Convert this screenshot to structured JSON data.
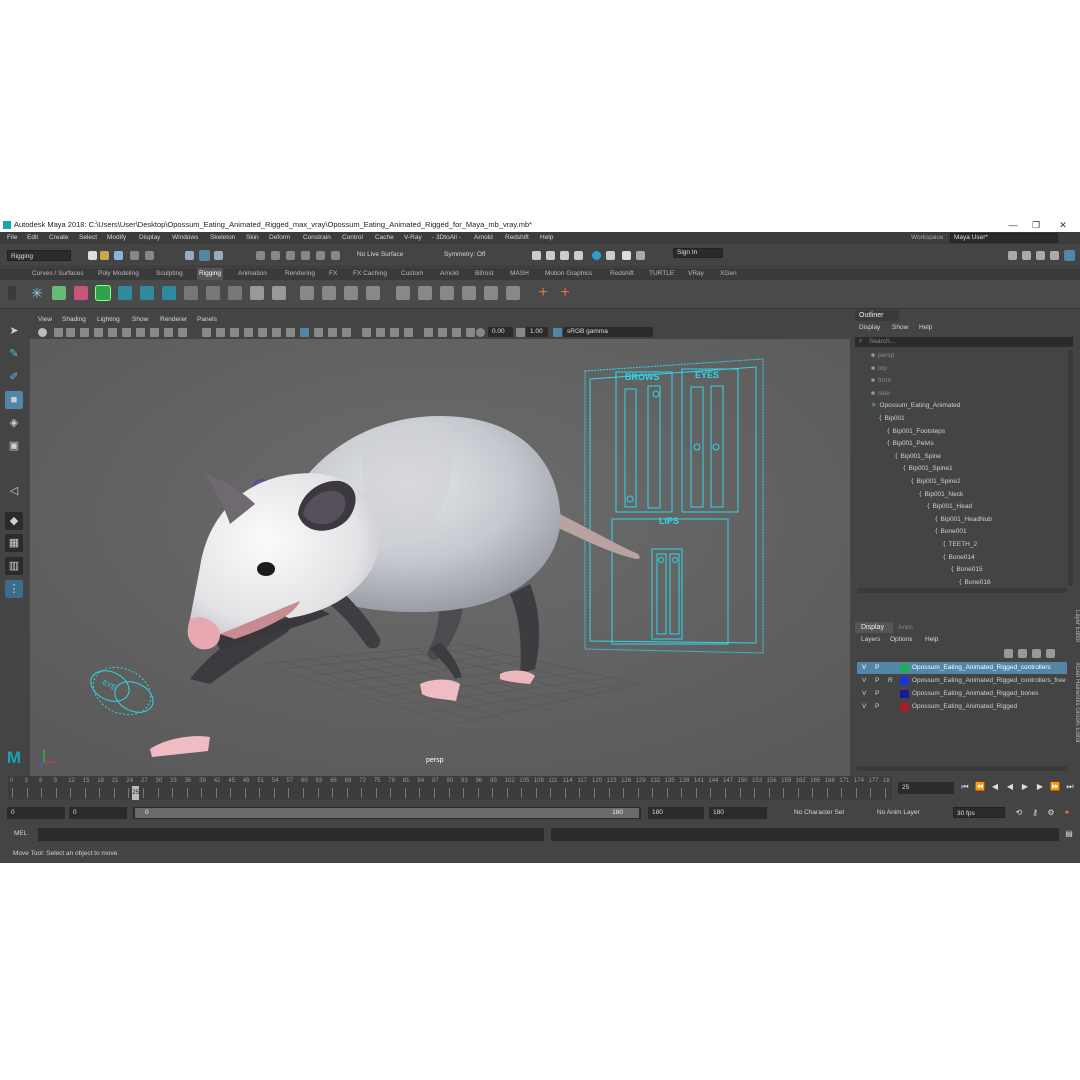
{
  "window": {
    "title": "Autodesk Maya 2018: C:\\Users\\User\\Desktop\\Opossum_Eating_Animated_Rigged_max_vray\\Opossum_Eating_Animated_Rigged_for_Maya_mb_vray.mb*",
    "minimize": "—",
    "maximize": "❐",
    "close": "✕"
  },
  "menubar": {
    "items": [
      "File",
      "Edit",
      "Create",
      "Select",
      "Modify",
      "Display",
      "Windows",
      "Skeleton",
      "Skin",
      "Deform",
      "Constrain",
      "Control",
      "Cache",
      "V-Ray",
      "- 3DtoAll -",
      "Arnold",
      "Redshift",
      "Help"
    ],
    "workspace_label": "Workspace :",
    "workspace_value": "Maya User*"
  },
  "statusline": {
    "mode": "Rigging",
    "live_surface": "No Live Surface",
    "symmetry": "Symmetry: Off",
    "sign_in": "Sign In"
  },
  "shelf": {
    "tabs": [
      "Curves / Surfaces",
      "Poly Modeling",
      "Sculpting",
      "Rigging",
      "Animation",
      "Rendering",
      "FX",
      "FX Caching",
      "Custom",
      "Arnold",
      "Bifrost",
      "MASH",
      "Motion Graphics",
      "Redshift",
      "TURTLE",
      "VRay",
      "XGen"
    ],
    "active_tab": "Rigging"
  },
  "viewport": {
    "menus": [
      "View",
      "Shading",
      "Lighting",
      "Show",
      "Renderer",
      "Panels"
    ],
    "exposure": "0.00",
    "gamma": "1.00",
    "color_space": "sRGB gamma",
    "camera_label": "persp",
    "controls": {
      "brows": "BROWS",
      "eyes": "EYES",
      "lips": "LIPS",
      "eye_ctrl": "EYE"
    }
  },
  "outliner": {
    "title": "Outliner",
    "menus": [
      "Display",
      "Show",
      "Help"
    ],
    "search_placeholder": "Search...",
    "rows": [
      {
        "label": "persp",
        "depth": 0,
        "dim": true
      },
      {
        "label": "top",
        "depth": 0,
        "dim": true
      },
      {
        "label": "front",
        "depth": 0,
        "dim": true
      },
      {
        "label": "side",
        "depth": 0,
        "dim": true
      },
      {
        "label": "Opossum_Eating_Animated",
        "depth": 0,
        "dim": false
      },
      {
        "label": "Bip001",
        "depth": 1,
        "dim": false
      },
      {
        "label": "Bip001_Footsteps",
        "depth": 2,
        "dim": false
      },
      {
        "label": "Bip001_Pelvis",
        "depth": 2,
        "dim": false
      },
      {
        "label": "Bip001_Spine",
        "depth": 3,
        "dim": false
      },
      {
        "label": "Bip001_Spine1",
        "depth": 4,
        "dim": false
      },
      {
        "label": "Bip001_Spine2",
        "depth": 5,
        "dim": false
      },
      {
        "label": "Bip001_Neck",
        "depth": 6,
        "dim": false
      },
      {
        "label": "Bip001_Head",
        "depth": 7,
        "dim": false
      },
      {
        "label": "Bip001_HeadNub",
        "depth": 8,
        "dim": false
      },
      {
        "label": "Bone001",
        "depth": 8,
        "dim": false
      },
      {
        "label": "TEETH_2",
        "depth": 9,
        "dim": false
      },
      {
        "label": "Bone014",
        "depth": 9,
        "dim": false
      },
      {
        "label": "Bone015",
        "depth": 10,
        "dim": false
      },
      {
        "label": "Bone016",
        "depth": 11,
        "dim": false
      }
    ]
  },
  "layer_editor": {
    "tabs": [
      "Display",
      "Anim"
    ],
    "menus": [
      "Layers",
      "Options",
      "Help"
    ],
    "side_labels": [
      "Layer Editor",
      "XGen Hairworks Groom Editor"
    ],
    "layers": [
      {
        "v": "V",
        "p": "P",
        "r": "",
        "color": "#22aa55",
        "name": "Opossum_Eating_Animated_Rigged_controllers",
        "selected": true
      },
      {
        "v": "V",
        "p": "P",
        "r": "R",
        "color": "#1a33dd",
        "name": "Opossum_Eating_Animated_Rigged_controllers_free",
        "selected": false
      },
      {
        "v": "V",
        "p": "P",
        "r": "",
        "color": "#1a1a99",
        "name": "Opossum_Eating_Animated_Rigged_bones",
        "selected": false
      },
      {
        "v": "V",
        "p": "P",
        "r": "",
        "color": "#aa1a2a",
        "name": "Opossum_Eating_Animated_Rigged",
        "selected": false
      }
    ]
  },
  "timeline": {
    "ticks": [
      "0",
      "3",
      "6",
      "9",
      "12",
      "15",
      "18",
      "21",
      "24",
      "27",
      "30",
      "33",
      "36",
      "39",
      "42",
      "45",
      "48",
      "51",
      "54",
      "57",
      "60",
      "63",
      "66",
      "69",
      "72",
      "75",
      "78",
      "81",
      "84",
      "87",
      "90",
      "93",
      "96",
      "99",
      "102",
      "105",
      "108",
      "111",
      "114",
      "117",
      "120",
      "123",
      "126",
      "129",
      "132",
      "135",
      "138",
      "141",
      "144",
      "147",
      "150",
      "153",
      "156",
      "159",
      "162",
      "165",
      "168",
      "171",
      "174",
      "177",
      "18"
    ],
    "current_frame": "25",
    "current_field": "25",
    "range_start": "0",
    "range_start2": "0",
    "slider_start": "0",
    "slider_end": "180",
    "range_end": "180",
    "range_end2": "180",
    "character_set": "No Character Set",
    "anim_layer": "No Anim Layer",
    "fps": "30 fps"
  },
  "command": {
    "language": "MEL",
    "help_text": "Move Tool: Select an object to move."
  }
}
